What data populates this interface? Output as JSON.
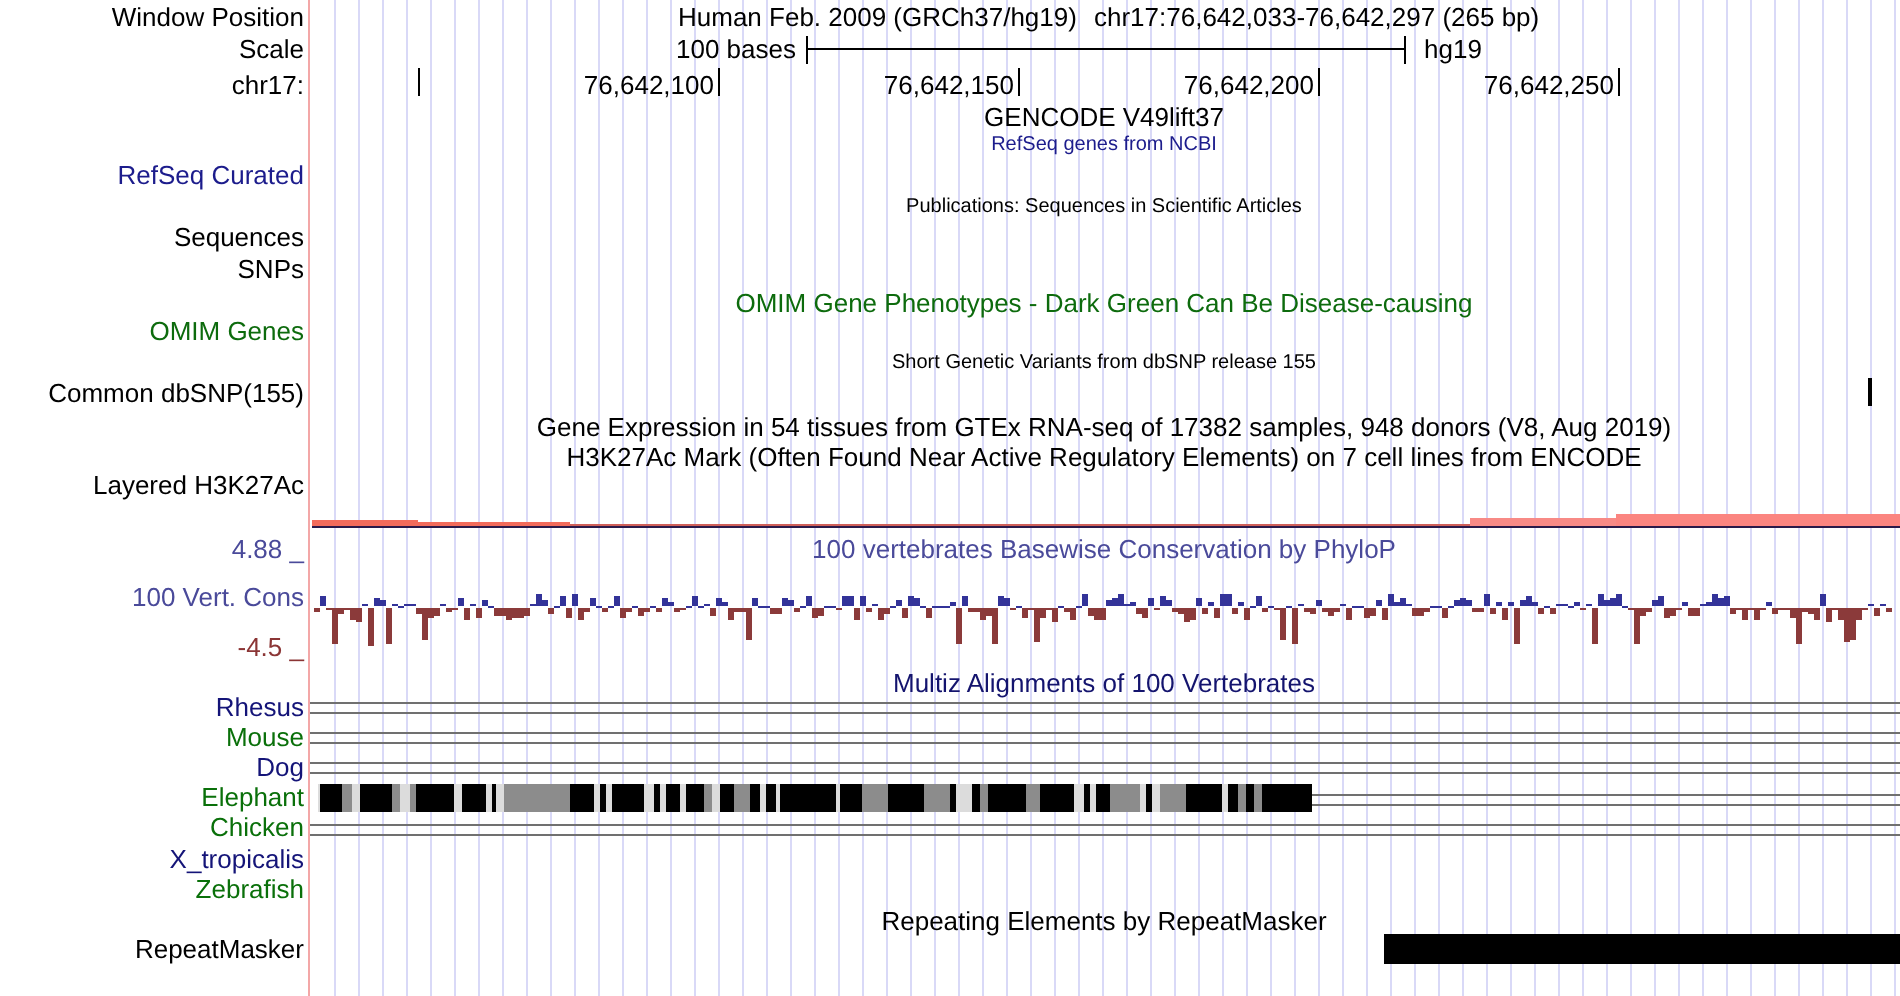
{
  "header": {
    "window_position_label": "Window Position",
    "assembly": "Human Feb. 2009 (GRCh37/hg19)",
    "position": "chr17:76,642,033-76,642,297 (265 bp)",
    "scale_label": "Scale",
    "scale_text": "100 bases",
    "scale_db": "hg19",
    "chrom_label": "chr17:",
    "ticks": [
      "76,642,100",
      "76,642,150",
      "76,642,200",
      "76,642,250"
    ]
  },
  "tracks": [
    {
      "kind": "title",
      "title": "GENCODE V49lift37",
      "color": "#000000"
    },
    {
      "kind": "small",
      "title": "RefSeq genes from NCBI",
      "labels": [
        "RefSeq Curated"
      ],
      "color": "#1c1c8c"
    },
    {
      "kind": "small",
      "title": "Publications: Sequences in Scientific Articles",
      "labels": [
        "Sequences",
        "SNPs"
      ],
      "color": "#000000"
    },
    {
      "kind": "title",
      "title": "OMIM Gene Phenotypes - Dark Green Can Be Disease-causing",
      "labels": [
        "OMIM Genes"
      ],
      "color": "#0d6b0d"
    },
    {
      "kind": "snp",
      "title": "Short Genetic Variants from dbSNP release 155",
      "labels": [
        "Common dbSNP(155)"
      ],
      "color": "#000000"
    },
    {
      "kind": "title",
      "title": "Gene Expression in 54 tissues from GTEx RNA-seq of 17382 samples, 948 donors (V8, Aug 2019)",
      "color": "#000000"
    },
    {
      "kind": "signal",
      "title": "H3K27Ac Mark (Often Found Near Active Regulatory Elements) on 7 cell lines from ENCODE",
      "labels": [
        "Layered H3K27Ac"
      ],
      "color": "#000000"
    },
    {
      "kind": "conservation",
      "title": "100 vertebrates Basewise Conservation by PhyloP",
      "labels": [
        "100 Vert. Cons"
      ],
      "y_max": "4.88 _",
      "y_min": "-4.5 _",
      "color": "#4a4a9a"
    },
    {
      "kind": "multiz",
      "title": "Multiz Alignments of 100 Vertebrates",
      "color": "#14146e",
      "species": [
        {
          "name": "Rhesus",
          "kind": "gap",
          "color": "#141478"
        },
        {
          "name": "Mouse",
          "kind": "gap",
          "color": "#0a700a"
        },
        {
          "name": "Dog",
          "kind": "gap",
          "color": "#141478"
        },
        {
          "name": "Elephant",
          "kind": "aligned",
          "color": "#0a700a"
        },
        {
          "name": "Chicken",
          "kind": "gap",
          "color": "#0a700a"
        },
        {
          "name": "X_tropicalis",
          "kind": "none",
          "color": "#141478"
        },
        {
          "name": "Zebrafish",
          "kind": "none",
          "color": "#0a700a"
        }
      ]
    },
    {
      "kind": "repeat",
      "title": "Repeating Elements by RepeatMasker",
      "labels": [
        "RepeatMasker"
      ],
      "color": "#000000"
    }
  ]
}
